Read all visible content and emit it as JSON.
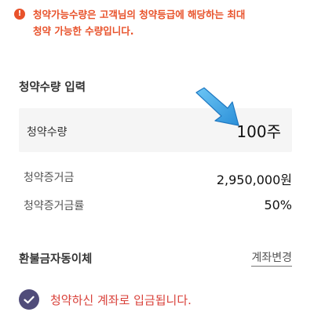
{
  "notice": {
    "icon": "exclamation-icon",
    "text_line1": "청약가능수량은 고객님의 청약등급에 해당하는 최대",
    "text_line2": "청약 가능한 수량입니다.",
    "color": "#e8522b"
  },
  "subscription": {
    "section_title": "청약수량 입력",
    "quantity_label": "청약수량",
    "quantity_value": "100주",
    "deposit_label": "청약증거금",
    "deposit_value": "2,950,000원",
    "deposit_rate_label": "청약증거금률",
    "deposit_rate_value": "50%"
  },
  "refund": {
    "title": "환불금자동이체",
    "change_account_label": "계좌변경",
    "check_icon": "check-circle-icon",
    "message": "청약하신 계좌로 입금됩니다.",
    "message_color": "#d9413a"
  },
  "annotation": {
    "arrow_icon": "blue-pointer-arrow-icon",
    "color": "#3aa7e6"
  }
}
